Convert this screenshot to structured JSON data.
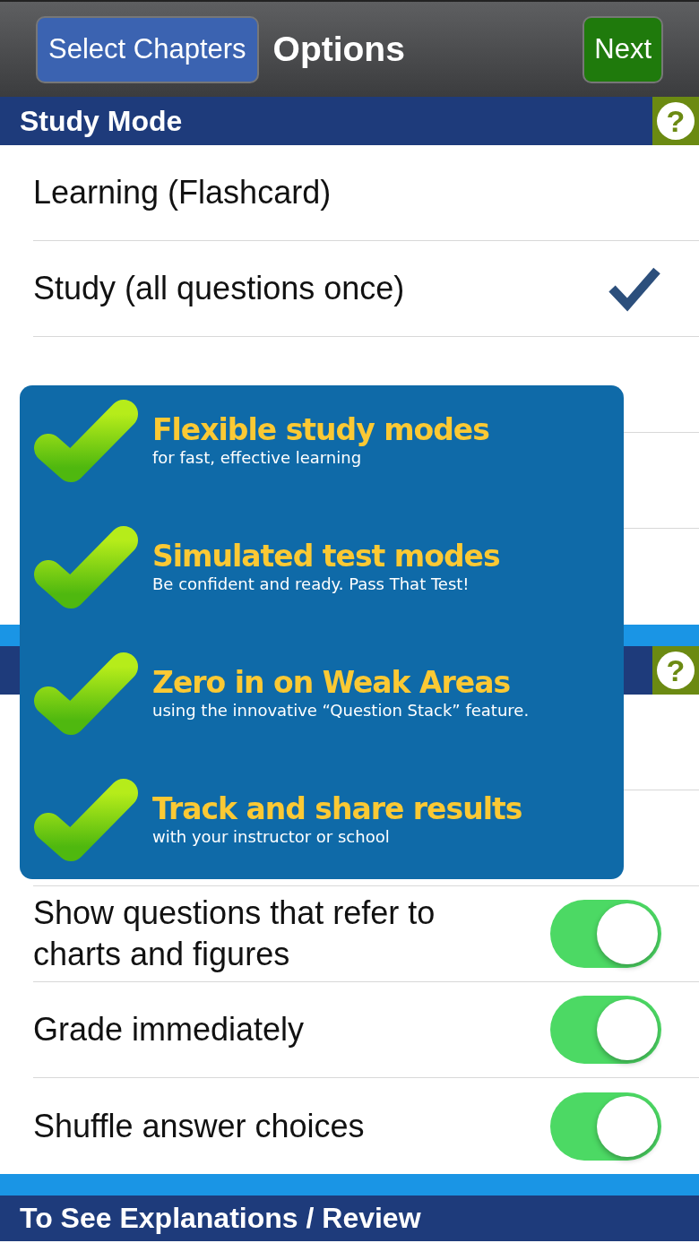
{
  "nav": {
    "back": "Select Chapters",
    "title": "Options",
    "next": "Next"
  },
  "sections": [
    {
      "title": "Study Mode",
      "help": "?",
      "strip": false,
      "rows": [
        {
          "kind": "choice",
          "label": "Learning (Flashcard)",
          "selected": false
        },
        {
          "kind": "choice",
          "label": "Study (all questions once)",
          "selected": true
        },
        {
          "kind": "blank"
        },
        {
          "kind": "blank"
        },
        {
          "kind": "blank"
        }
      ]
    },
    {
      "help": "?",
      "strip": true,
      "rows": [
        {
          "kind": "blank"
        },
        {
          "kind": "blank"
        },
        {
          "kind": "toggle",
          "label": "Show questions that refer to charts and figures",
          "on": true
        },
        {
          "kind": "toggle",
          "label": "Grade immediately",
          "on": true
        },
        {
          "kind": "toggle",
          "label": "Shuffle answer choices",
          "on": true
        }
      ]
    },
    {
      "title": "To See Explanations / Review",
      "strip": true
    }
  ],
  "promo": {
    "items": [
      {
        "title": "Flexible study modes",
        "subtitle": "for fast, effective learning"
      },
      {
        "title": "Simulated test modes",
        "subtitle": "Be confident and ready.  Pass That Test!"
      },
      {
        "title": "Zero in on Weak Areas",
        "subtitle": "using the innovative “Question Stack” feature."
      },
      {
        "title": "Track and share results",
        "subtitle": "with your instructor or school"
      }
    ]
  }
}
